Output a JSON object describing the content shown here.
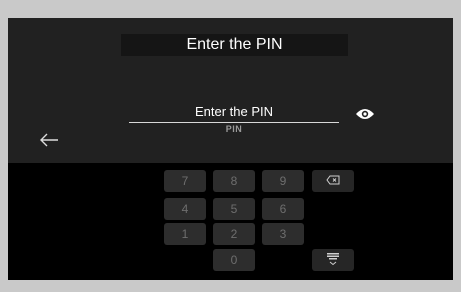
{
  "header": {
    "title": "Enter the PIN"
  },
  "pin_field": {
    "value": "Enter the PIN",
    "sublabel": "PIN"
  },
  "icons": {
    "eye": "eye-icon",
    "back": "arrow-left-icon",
    "backspace": "backspace-icon",
    "keyboard": "keyboard-hide-icon"
  },
  "keypad": {
    "row1": [
      "7",
      "8",
      "9"
    ],
    "row2": [
      "4",
      "5",
      "6"
    ],
    "row3": [
      "1",
      "2",
      "3"
    ],
    "row4": [
      "0"
    ]
  },
  "colors": {
    "top_panel": "#212121",
    "keypad_bg": "#000000",
    "key": "#2d2d2d",
    "frame": "#c9c9c9"
  }
}
